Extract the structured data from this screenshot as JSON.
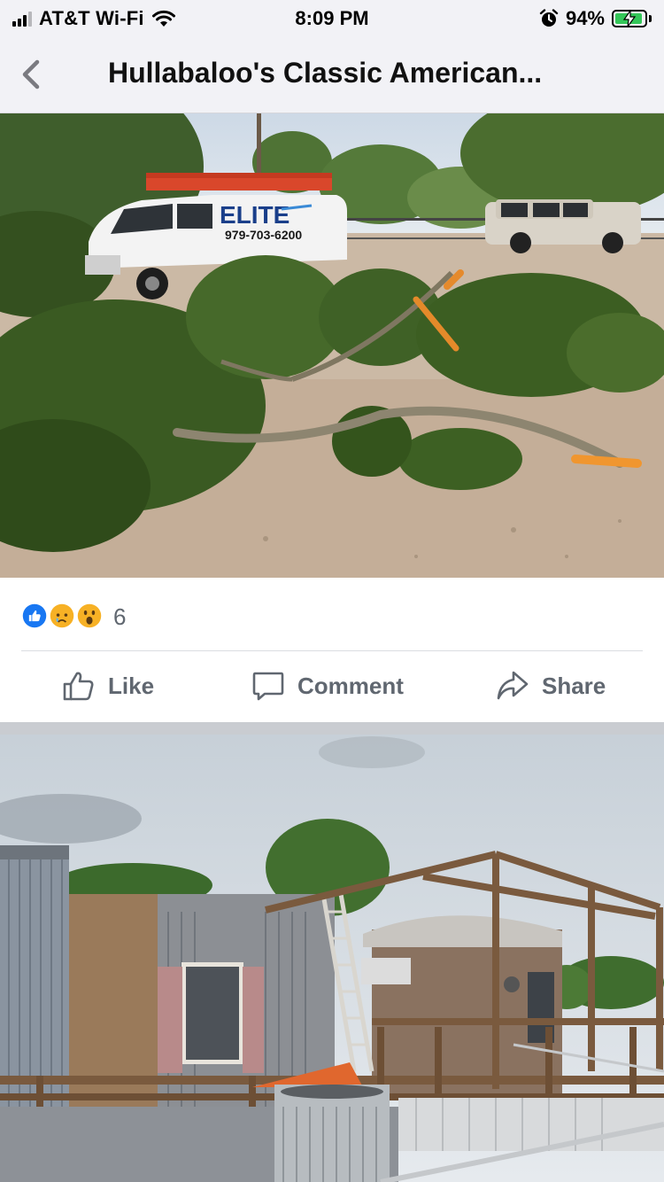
{
  "status_bar": {
    "carrier": "AT&T Wi-Fi",
    "time": "8:09 PM",
    "battery_percent": "94%",
    "battery_level": 0.94
  },
  "header": {
    "title": "Hullabaloo's Classic American..."
  },
  "post1": {
    "photo": {
      "van_brand": "ELITE",
      "van_phone": "979-703-6200"
    },
    "reaction_count": "6",
    "actions": {
      "like": "Like",
      "comment": "Comment",
      "share": "Share"
    }
  },
  "colors": {
    "facebook_blue": "#1877f2",
    "action_gray": "#606770",
    "status_green": "#34c759"
  },
  "icons": [
    "back-chevron-icon",
    "wifi-icon",
    "alarm-icon",
    "battery-icon",
    "like-reaction-icon",
    "sad-reaction-icon",
    "wow-reaction-icon",
    "thumbs-up-icon",
    "comment-icon",
    "share-icon"
  ]
}
